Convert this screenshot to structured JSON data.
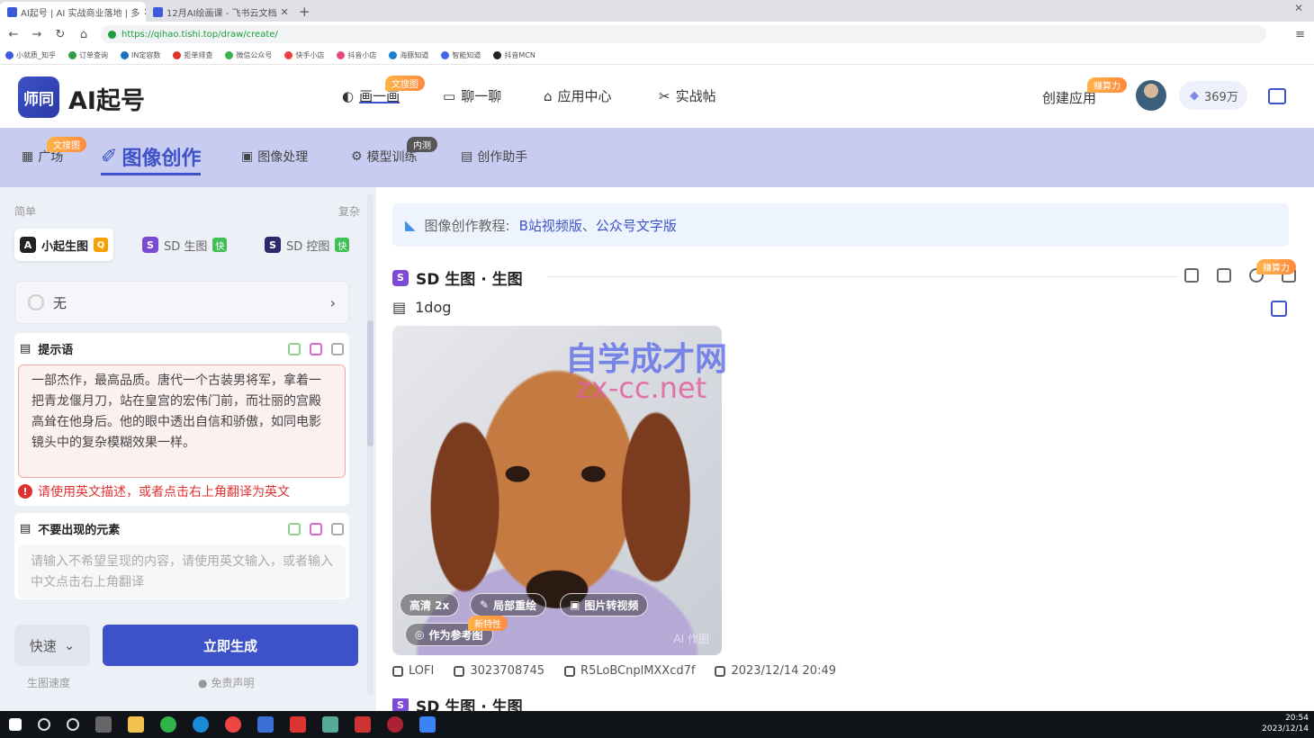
{
  "browser": {
    "tabs": [
      {
        "title": "AI起号 | AI 实战商业落地 | 多"
      },
      {
        "title": "12月AI绘画课 - 飞书云文档"
      }
    ],
    "url": "https://qihao.tishi.top/draw/create/",
    "bookmarks": [
      "小就质_知乎",
      "订单查询",
      "IN定容数",
      "拒单排查",
      "微信公众号",
      "快手小店",
      "抖音小店",
      "海豚知道",
      "智能知道",
      "抖音MCN"
    ]
  },
  "app": {
    "brand": "AI起号",
    "logo_text": "师同",
    "nav": [
      {
        "label": "画一画",
        "badge": "文搜图"
      },
      {
        "label": "聊一聊"
      },
      {
        "label": "应用中心"
      },
      {
        "label": "实战帖"
      }
    ],
    "create_app": "创建应用",
    "create_badge": "赚算力",
    "points": "369万"
  },
  "subnav": [
    {
      "label": "广场",
      "badge": "文搜图"
    },
    {
      "label": "图像创作"
    },
    {
      "label": "图像处理"
    },
    {
      "label": "模型训练",
      "badge": "内测"
    },
    {
      "label": "创作助手"
    }
  ],
  "left": {
    "mode_simple": "简单",
    "mode_complex": "复杂",
    "modes": [
      {
        "label": "小起生图",
        "icon": "A",
        "tag": "Q",
        "color": "#222222",
        "tag_color": "#f59f00"
      },
      {
        "label": "SD 生图",
        "icon": "S",
        "tag": "快",
        "color": "#7b4bd6",
        "tag_color": "#40c057"
      },
      {
        "label": "SD 控图",
        "icon": "S",
        "tag": "快",
        "color": "#2b2b6b",
        "tag_color": "#40c057"
      }
    ],
    "style_value": "无",
    "prompt_title": "提示语",
    "prompt_text": "一部杰作，最高品质。唐代一个古装男将军，拿着一把青龙偃月刀，站在皇宫的宏伟门前，而壮丽的宫殿高耸在他身后。他的眼中透出自信和骄傲，如同电影镜头中的复杂模糊效果一样。",
    "warning": "请使用英文描述，或者点击右上角翻译为英文",
    "negative_title": "不要出现的元素",
    "negative_placeholder": "请输入不希望呈现的内容，请使用英文输入，或者输入中文点击右上角翻译",
    "speed": "快速",
    "generate": "立即生成",
    "speed_label": "生图速度",
    "disclaimer": "免责声明"
  },
  "right": {
    "tutorial_prefix": "图像创作教程:",
    "tutorial_link1": "B站视频版",
    "tutorial_sep": "、",
    "tutorial_link2": "公众号文字版",
    "section_title": "SD 生图 · 生图",
    "section_badge": "赚算力",
    "prompt_name": "1dog",
    "image_buttons": {
      "hd": "高清 2x",
      "inpaint": "局部重绘",
      "img2video": "图片转视频",
      "as_ref": "作为参考图",
      "new_badge": "新特性"
    },
    "ai_mark": "AI 作图",
    "watermark1": "自学成才网",
    "watermark2": "zx-cc.net",
    "meta": {
      "model": "LOFI",
      "seed": "3023708745",
      "hash": "R5LoBCnplMXXcd7f",
      "time": "2023/12/14 20:49"
    },
    "next_section_title": "SD 生图 · 生图"
  },
  "taskbar": {
    "time": "20:54",
    "date": "2023/12/14"
  }
}
